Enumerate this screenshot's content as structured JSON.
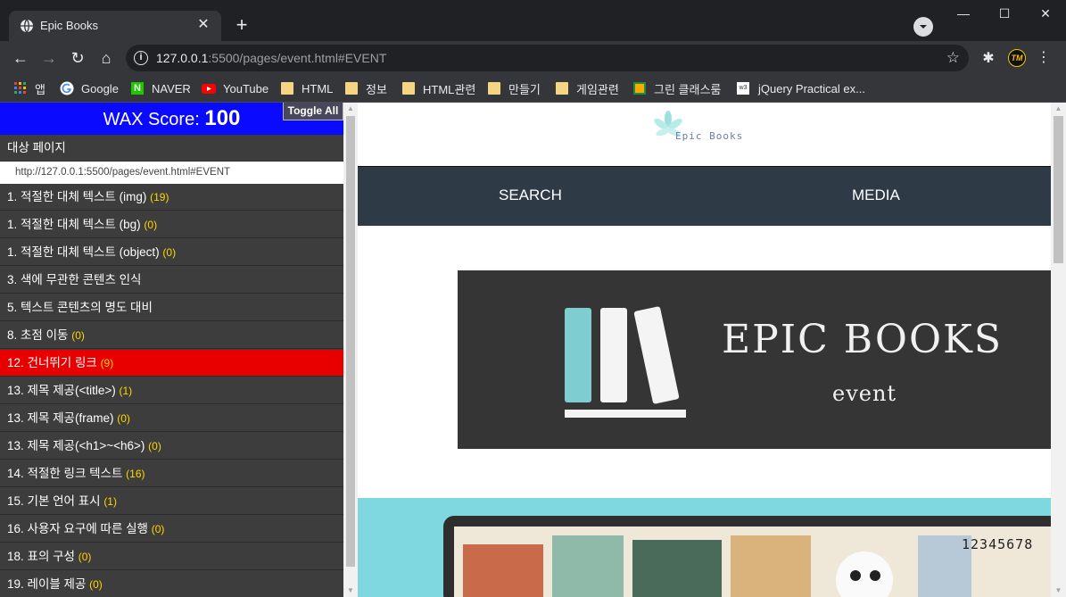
{
  "browser": {
    "tab_title": "Epic Books",
    "url_host": "127.0.0.1",
    "url_rest": ":5500/pages/event.html#EVENT",
    "window_controls": [
      "minimize-icon",
      "maximize-icon",
      "close-icon"
    ]
  },
  "bookmarks": [
    {
      "label": "앱",
      "icon": "apps-grid-icon"
    },
    {
      "label": "Google",
      "icon": "google-icon"
    },
    {
      "label": "NAVER",
      "icon": "naver-icon"
    },
    {
      "label": "YouTube",
      "icon": "youtube-icon"
    },
    {
      "label": "HTML",
      "icon": "folder-icon"
    },
    {
      "label": "정보",
      "icon": "folder-icon"
    },
    {
      "label": "HTML관련",
      "icon": "folder-icon"
    },
    {
      "label": "만들기",
      "icon": "folder-icon"
    },
    {
      "label": "게임관련",
      "icon": "folder-icon"
    },
    {
      "label": "그린 클래스룸",
      "icon": "classroom-icon"
    },
    {
      "label": "jQuery Practical ex...",
      "icon": "w3-icon"
    }
  ],
  "wax": {
    "score_label": "WAX Score:",
    "score_value": "100",
    "toggle_label": "Toggle All",
    "target_label": "대상 페이지",
    "target_url": "http://127.0.0.1:5500/pages/event.html#EVENT",
    "items": [
      {
        "label": "1. 적절한 대체 텍스트 (img)",
        "count": "(19)"
      },
      {
        "label": "1. 적절한 대체 텍스트 (bg)",
        "count": "(0)"
      },
      {
        "label": "1. 적절한 대체 텍스트 (object)",
        "count": "(0)"
      },
      {
        "label": "3. 색에 무관한 콘텐츠 인식",
        "count": ""
      },
      {
        "label": "5. 텍스트 콘텐츠의 명도 대비",
        "count": ""
      },
      {
        "label": "8. 초점 이동",
        "count": "(0)"
      },
      {
        "label": "12. 건너뛰기 링크",
        "count": "(9)"
      },
      {
        "label": "13. 제목 제공(<title>)",
        "count": "(1)"
      },
      {
        "label": "13. 제목 제공(frame)",
        "count": "(0)"
      },
      {
        "label": "13. 제목 제공(<h1>~<h6>)",
        "count": "(0)"
      },
      {
        "label": "14. 적절한 링크 텍스트",
        "count": "(16)"
      },
      {
        "label": "15. 기본 언어 표시",
        "count": "(1)"
      },
      {
        "label": "16. 사용자 요구에 따른 실행",
        "count": "(0)"
      },
      {
        "label": "18. 표의 구성",
        "count": "(0)"
      },
      {
        "label": "19. 레이블 제공",
        "count": "(0)"
      }
    ],
    "active_index": 6
  },
  "site": {
    "logo_text": "Epic Books",
    "nav": [
      "SEARCH",
      "MEDIA"
    ],
    "hero_title": "EPIC BOOKS",
    "hero_subtitle": "event",
    "banner_numbers": "12345678"
  },
  "colors": {
    "wax_score_bg": "#0a0aff",
    "wax_active_bg": "#e80000",
    "wax_count": "#ffd700",
    "nav_bg": "#2f3a47",
    "hero_bg": "#353535",
    "hero_book_accent": "#7ecdd1",
    "banner_bg": "#7fd7e0"
  }
}
